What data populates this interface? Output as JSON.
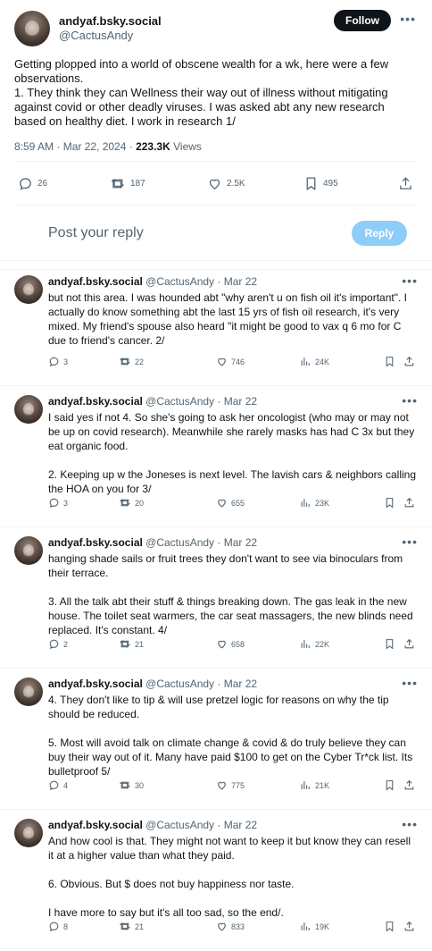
{
  "main": {
    "display_name": "andyaf.bsky.social",
    "handle": "@CactusAndy",
    "follow_label": "Follow",
    "text": "Getting plopped into a world of obscene wealth for a wk, here were a few observations.\n1. They think they can Wellness their way out of illness without mitigating against covid or other deadly viruses. I was asked abt any new research based on healthy diet. I work in research 1/",
    "time": "8:59 AM · Mar 22, 2024 · ",
    "views_count": "223.3K",
    "views_label": " Views",
    "replies": "26",
    "reposts": "187",
    "likes": "2.5K",
    "bookmarks": "495"
  },
  "reply_bar": {
    "placeholder": "Post your reply",
    "button": "Reply"
  },
  "thread": [
    {
      "name": "andyaf.bsky.social",
      "sub": " @CactusAndy · Mar 22",
      "text": "but not this area. I was hounded abt \"why aren't u on fish oil it's important\". I actually do know something abt the last 15 yrs of fish oil research, it's very mixed. My friend's spouse also heard \"it might be good to vax q 6 mo for C due to friend's cancer. 2/",
      "replies": "3",
      "reposts": "22",
      "likes": "746",
      "views": "24K"
    },
    {
      "name": "andyaf.bsky.social",
      "sub": " @CactusAndy · Mar 22",
      "text": "I said yes if not 4. So she's going to ask her oncologist (who may or may not be up on covid research). Meanwhile she rarely masks has had C 3x but they eat organic food.\n\n2. Keeping up w the Joneses is next level. The lavish cars & neighbors calling the HOA on you for 3/",
      "replies": "3",
      "reposts": "20",
      "likes": "655",
      "views": "23K"
    },
    {
      "name": "andyaf.bsky.social",
      "sub": " @CactusAndy · Mar 22",
      "text": "hanging shade sails or fruit trees they don't want to see via binoculars from their terrace.\n\n3. All the talk abt their stuff & things breaking down. The gas leak in the new house. The toilet seat warmers, the car seat massagers, the new blinds need replaced. It's constant. 4/",
      "replies": "2",
      "reposts": "21",
      "likes": "658",
      "views": "22K"
    },
    {
      "name": "andyaf.bsky.social",
      "sub": " @CactusAndy · Mar 22",
      "text": "4. They don't like to tip & will use pretzel logic for reasons on why the tip should be reduced.\n\n5. Most will avoid talk on climate change & covid & do truly believe they can buy their way out of it. Many have paid $100 to get on the Cyber Tr*ck list. Its bulletproof 5/",
      "replies": "4",
      "reposts": "30",
      "likes": "775",
      "views": "21K"
    },
    {
      "name": "andyaf.bsky.social",
      "sub": " @CactusAndy · Mar 22",
      "text": "And how cool is that. They might not want to keep it but know they can resell it at a higher value than what they paid.\n\n6. Obvious. But $ does not buy happiness nor taste.\n\nI have more to say but it's all too sad, so the end/.",
      "replies": "8",
      "reposts": "21",
      "likes": "833",
      "views": "19K"
    }
  ],
  "icons": {
    "reply": "reply-icon",
    "repost": "repost-icon",
    "like": "heart-icon",
    "views": "views-icon",
    "bookmark": "bookmark-icon",
    "share": "share-icon"
  },
  "colors": {
    "text": "#0f1419",
    "muted": "#536471",
    "reply_button": "#8ecdf8",
    "follow_button": "#0f1419"
  }
}
